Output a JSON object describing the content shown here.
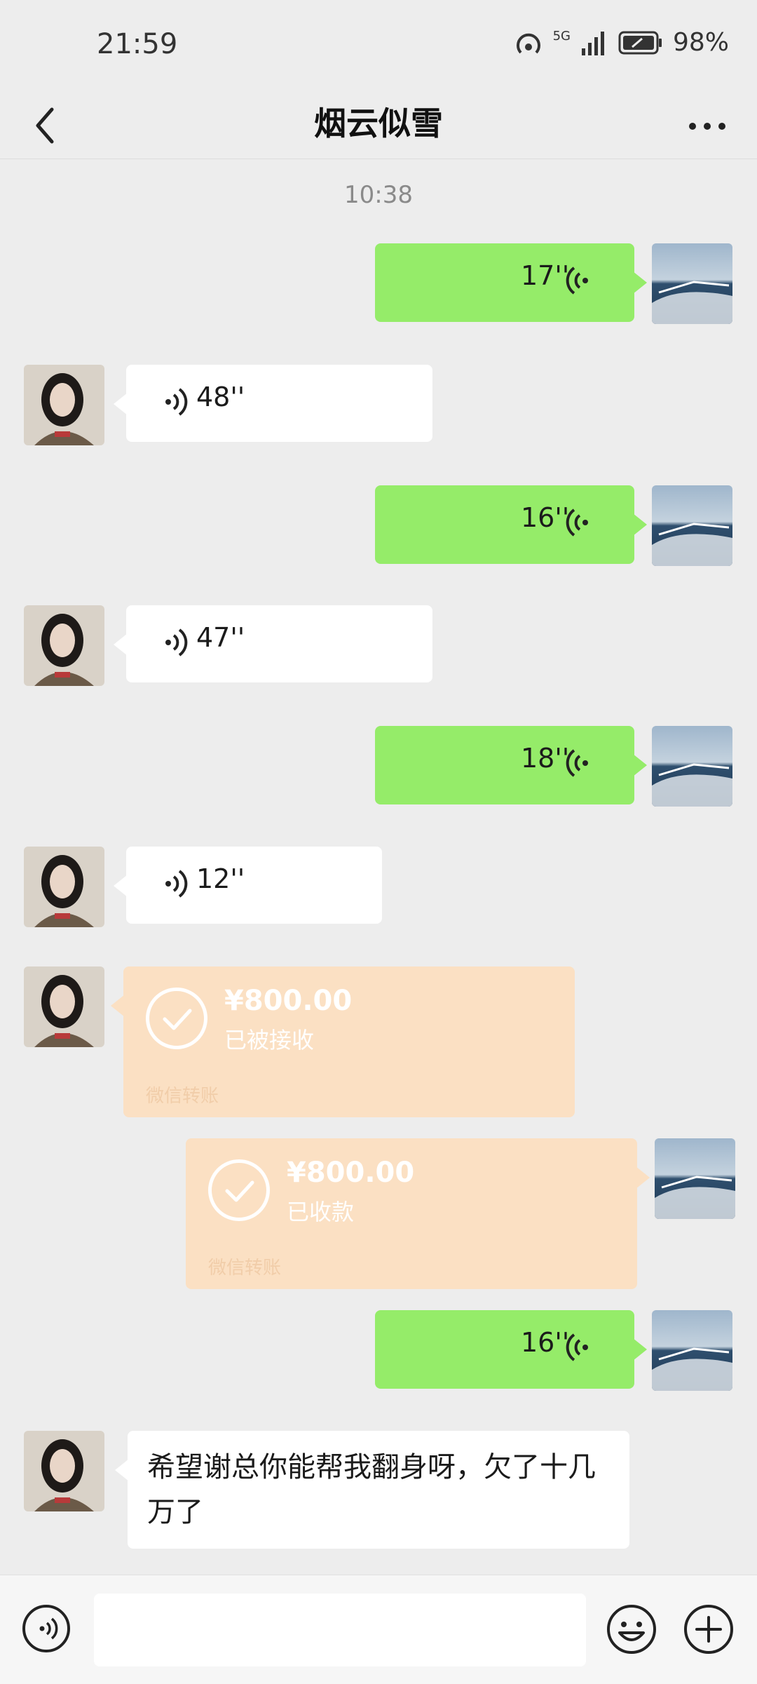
{
  "status": {
    "time": "21:59",
    "battery": "98%",
    "signal": "5G"
  },
  "header": {
    "title": "烟云似雪"
  },
  "chat": {
    "timestamp": "10:38",
    "messages": [
      {
        "side": "right",
        "type": "voice",
        "duration": "17''"
      },
      {
        "side": "left",
        "type": "voice",
        "duration": "48''"
      },
      {
        "side": "right",
        "type": "voice",
        "duration": "16''"
      },
      {
        "side": "left",
        "type": "voice",
        "duration": "47''"
      },
      {
        "side": "right",
        "type": "voice",
        "duration": "18''"
      },
      {
        "side": "left",
        "type": "voice",
        "duration": "12''"
      },
      {
        "side": "left",
        "type": "transfer",
        "amount": "¥800.00",
        "status": "已被接收",
        "footer": "微信转账"
      },
      {
        "side": "right",
        "type": "transfer",
        "amount": "¥800.00",
        "status": "已收款",
        "footer": "微信转账"
      },
      {
        "side": "right",
        "type": "voice",
        "duration": "16''"
      },
      {
        "side": "left",
        "type": "text",
        "text": "希望谢总你能帮我翻身呀，欠了十几万了"
      }
    ]
  },
  "input": {
    "placeholder": ""
  },
  "colors": {
    "sent": "#95ec69",
    "received": "#ffffff",
    "transfer": "#fbe0c3",
    "background": "#ededed"
  }
}
